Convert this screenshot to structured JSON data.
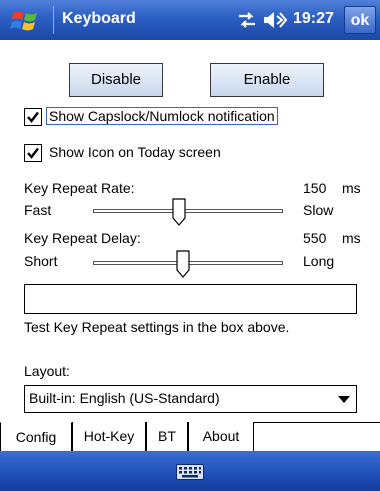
{
  "titlebar": {
    "app_title": "Keyboard",
    "clock": "19:27",
    "ok_label": "ok",
    "icons": [
      "windows-start-icon",
      "connectivity-icon",
      "volume-icon"
    ]
  },
  "buttons": {
    "disable_label": "Disable",
    "enable_label": "Enable"
  },
  "options": {
    "capslock_label": "Show Capslock/Numlock notification",
    "capslock_checked": true,
    "today_icon_label": "Show Icon on Today screen",
    "today_icon_checked": true
  },
  "repeat_rate": {
    "label": "Key Repeat Rate:",
    "value": "150",
    "unit": "ms",
    "min_label": "Fast",
    "max_label": "Slow",
    "level": 0.45
  },
  "repeat_delay": {
    "label": "Key Repeat Delay:",
    "value": "550",
    "unit": "ms",
    "min_label": "Short",
    "max_label": "Long",
    "level": 0.47
  },
  "test_box": {
    "value": "",
    "hint": "Test Key Repeat settings in the box above."
  },
  "layout": {
    "label": "Layout:",
    "selected": "Built-in: English (US-Standard)"
  },
  "tabs": [
    {
      "label": "Config",
      "active": true
    },
    {
      "label": "Hot-Key",
      "active": false
    },
    {
      "label": "BT",
      "active": false
    },
    {
      "label": "About",
      "active": false
    }
  ],
  "menubar": {
    "icon": "keyboard-icon"
  },
  "colors": {
    "titlebar": "#2c5fc4",
    "menubar": "#1f4fb8",
    "focus_border": "#3c63c2"
  }
}
